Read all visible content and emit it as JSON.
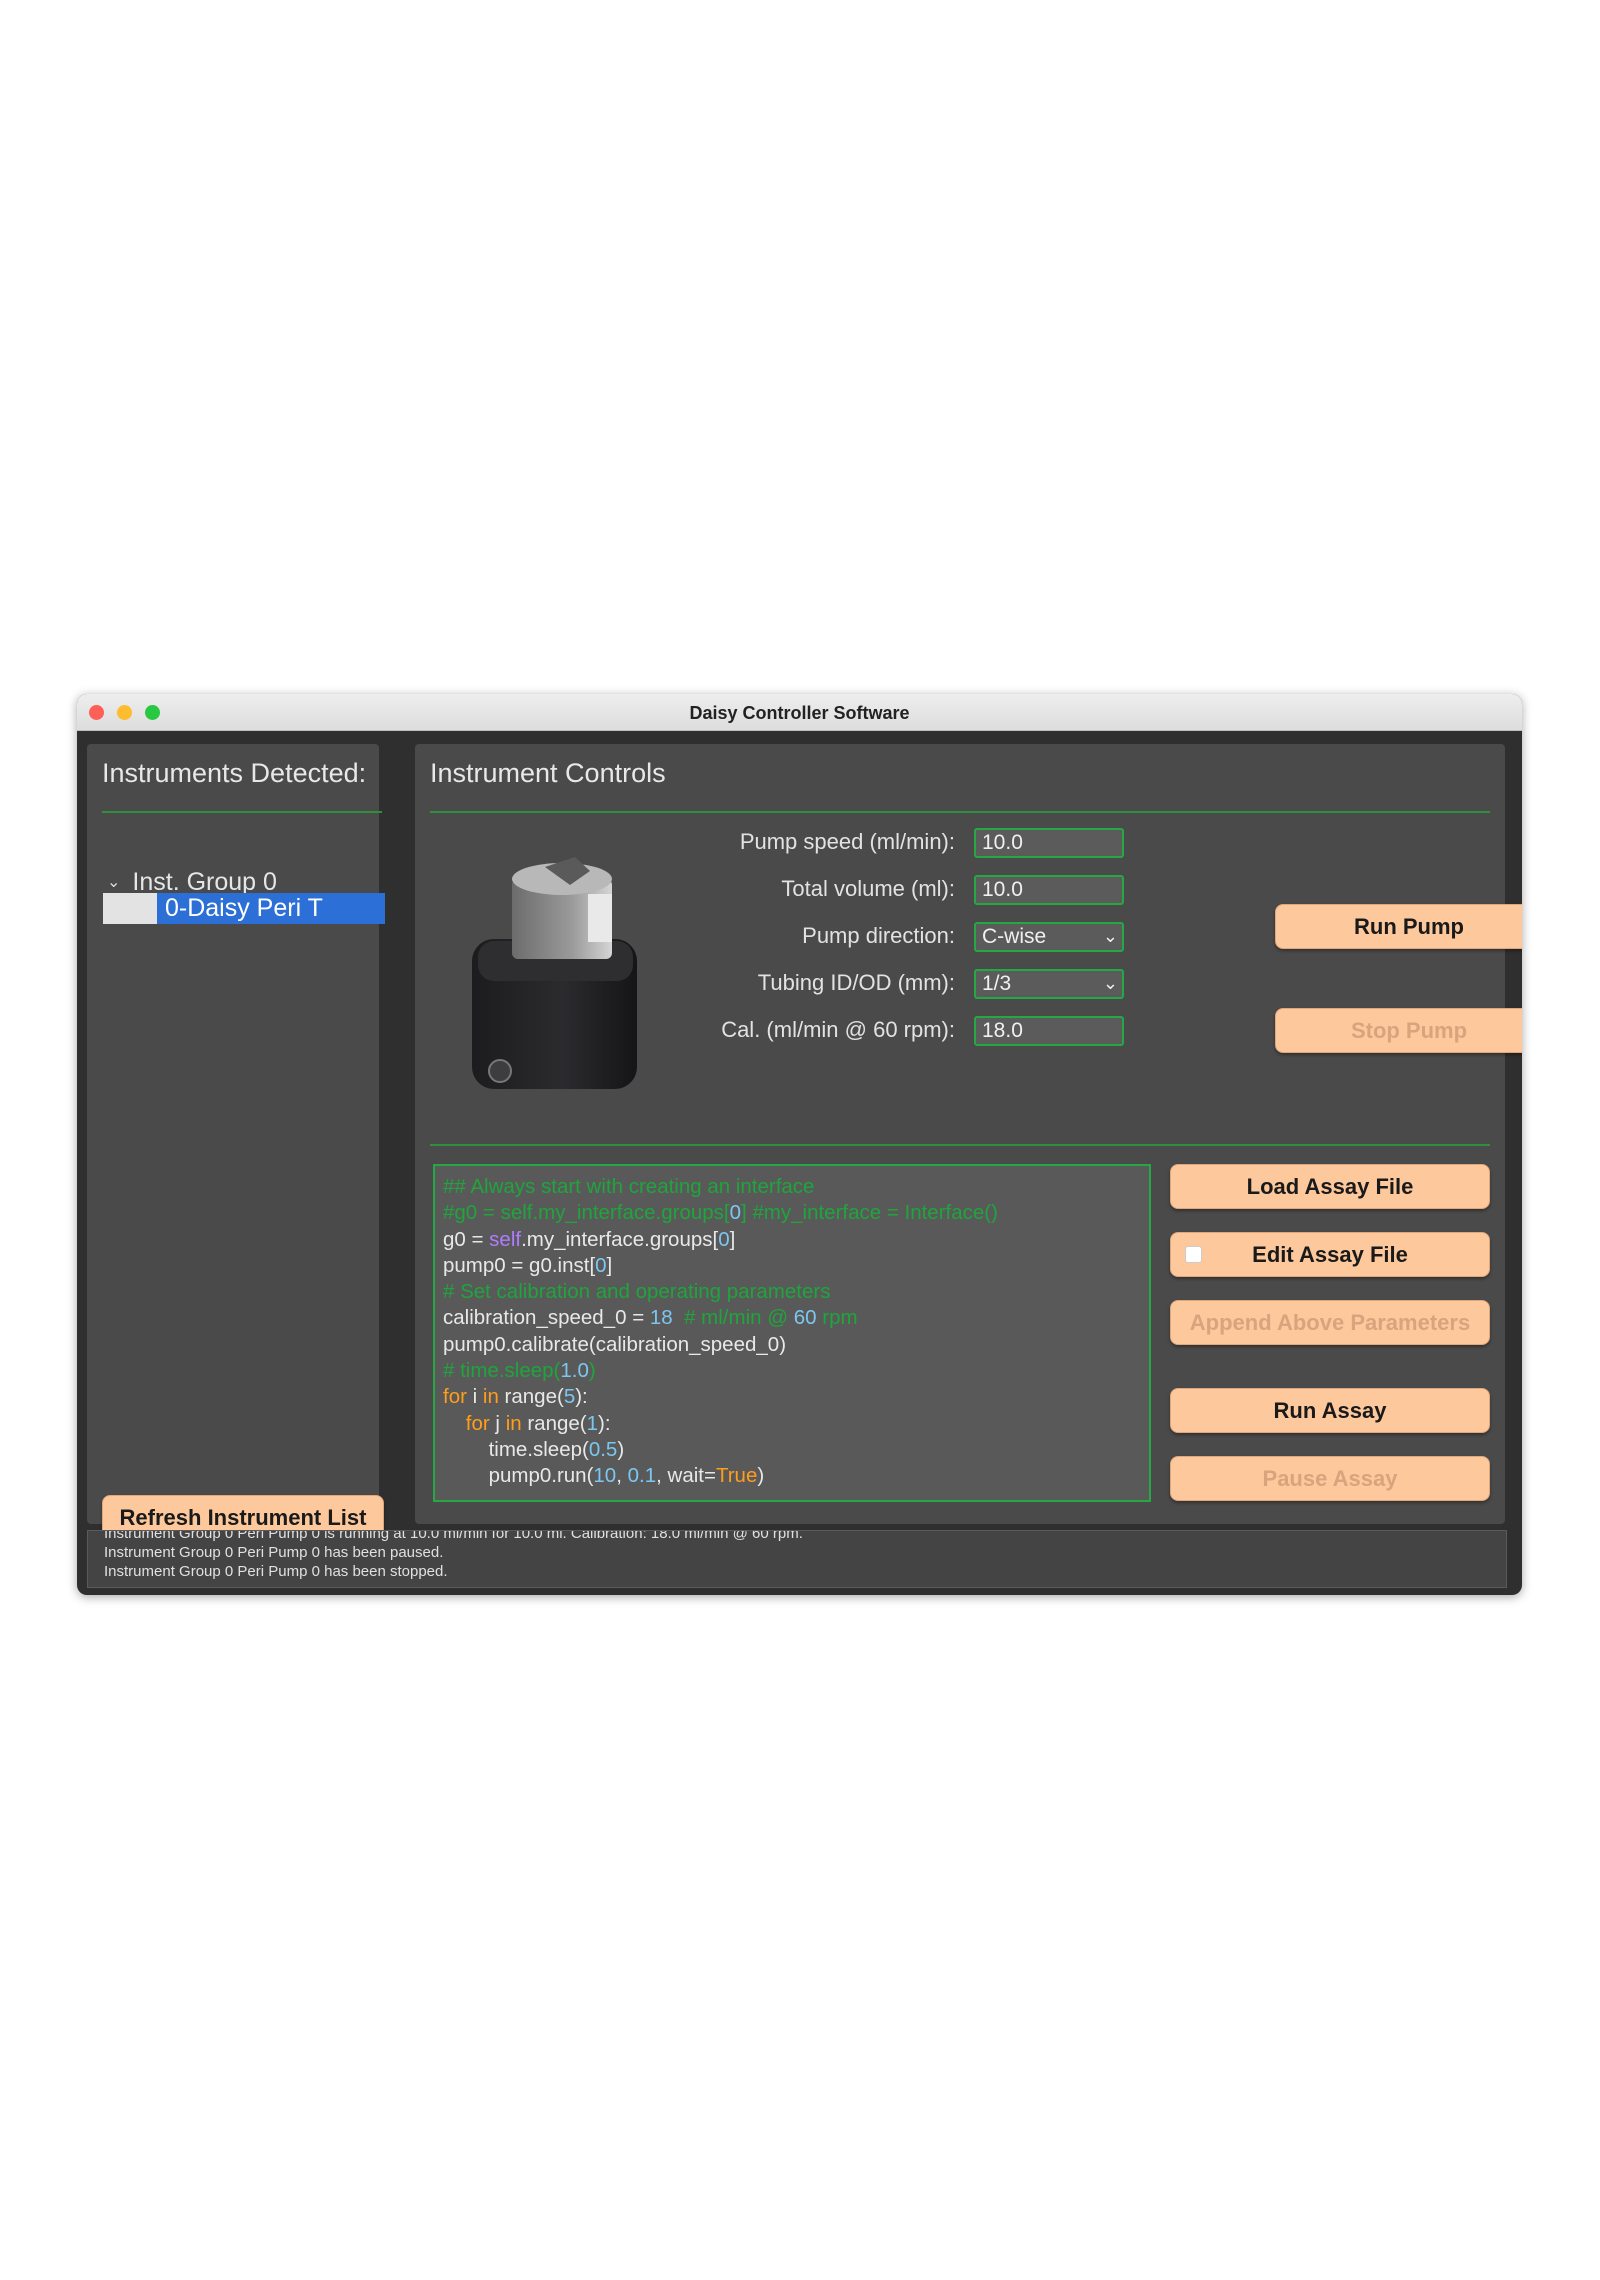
{
  "window": {
    "title": "Daisy Controller Software"
  },
  "instruments_panel": {
    "heading": "Instruments Detected:",
    "groups": [
      {
        "label": "Inst. Group 0",
        "items": [
          {
            "label": "0-Daisy Peri T",
            "selected": true
          }
        ]
      }
    ],
    "refresh_button": "Refresh Instrument List"
  },
  "controls_panel": {
    "heading": "Instrument Controls",
    "device_image": "peristaltic-pump-photo",
    "params": [
      {
        "label": "Pump speed (ml/min):",
        "value": "10.0",
        "kind": "text"
      },
      {
        "label": "Total volume (ml):",
        "value": "10.0",
        "kind": "text"
      },
      {
        "label": "Pump direction:",
        "value": "C-wise",
        "kind": "select"
      },
      {
        "label": "Tubing ID/OD (mm):",
        "value": "1/3",
        "kind": "select"
      },
      {
        "label": "Cal. (ml/min @ 60 rpm):",
        "value": "18.0",
        "kind": "text"
      }
    ],
    "run_pump_button": "Run Pump",
    "stop_pump_button": "Stop Pump",
    "stop_pump_enabled": false
  },
  "assay": {
    "code_lines": [
      [
        {
          "t": "## Always start with creating an interface",
          "c": "comment"
        }
      ],
      [
        {
          "t": "#g0 = self.my_interface.groups[",
          "c": "comment"
        },
        {
          "t": "0",
          "c": "num"
        },
        {
          "t": "] #my_interface = Interface()",
          "c": "comment"
        }
      ],
      [
        {
          "t": "g0 = ",
          "c": "plain"
        },
        {
          "t": "self",
          "c": "self"
        },
        {
          "t": ".my_interface.groups[",
          "c": "plain"
        },
        {
          "t": "0",
          "c": "num"
        },
        {
          "t": "]",
          "c": "plain"
        }
      ],
      [
        {
          "t": "pump0 = g0.inst[",
          "c": "plain"
        },
        {
          "t": "0",
          "c": "num"
        },
        {
          "t": "]",
          "c": "plain"
        }
      ],
      [
        {
          "t": "# Set calibration and operating parameters",
          "c": "comment"
        }
      ],
      [
        {
          "t": "calibration_speed_0 = ",
          "c": "plain"
        },
        {
          "t": "18",
          "c": "num"
        },
        {
          "t": "  # ml/min @ ",
          "c": "comment"
        },
        {
          "t": "60",
          "c": "num"
        },
        {
          "t": " rpm",
          "c": "comment"
        }
      ],
      [
        {
          "t": "pump0.calibrate(calibration_speed_0)",
          "c": "plain"
        }
      ],
      [
        {
          "t": "# time.sleep(",
          "c": "comment"
        },
        {
          "t": "1.0",
          "c": "num"
        },
        {
          "t": ")",
          "c": "comment"
        }
      ],
      [
        {
          "t": "for",
          "c": "kw"
        },
        {
          "t": " i ",
          "c": "plain"
        },
        {
          "t": "in",
          "c": "kw"
        },
        {
          "t": " range(",
          "c": "plain"
        },
        {
          "t": "5",
          "c": "num"
        },
        {
          "t": "):",
          "c": "plain"
        }
      ],
      [
        {
          "t": "    ",
          "c": "plain"
        },
        {
          "t": "for",
          "c": "kw"
        },
        {
          "t": " j ",
          "c": "plain"
        },
        {
          "t": "in",
          "c": "kw"
        },
        {
          "t": " range(",
          "c": "plain"
        },
        {
          "t": "1",
          "c": "num"
        },
        {
          "t": "):",
          "c": "plain"
        }
      ],
      [
        {
          "t": "        time.sleep(",
          "c": "plain"
        },
        {
          "t": "0.5",
          "c": "num"
        },
        {
          "t": ")",
          "c": "plain"
        }
      ],
      [
        {
          "t": "        pump0.run(",
          "c": "plain"
        },
        {
          "t": "10",
          "c": "num"
        },
        {
          "t": ", ",
          "c": "plain"
        },
        {
          "t": "0.1",
          "c": "num"
        },
        {
          "t": ", wait=",
          "c": "plain"
        },
        {
          "t": "True",
          "c": "kw"
        },
        {
          "t": ")",
          "c": "plain"
        }
      ]
    ],
    "load_button": "Load Assay File",
    "edit_button": "Edit Assay File",
    "edit_checked": false,
    "append_button": "Append Above Parameters",
    "append_enabled": false,
    "run_button": "Run Assay",
    "pause_button": "Pause Assay",
    "pause_enabled": false
  },
  "log": {
    "lines": [
      "Instrument Group 0 Peri Pump 0 is running at  10.0 ml/min for 10.0 ml. Calibration: 18.0 ml/min @ 60 rpm.",
      "Instrument Group 0 Peri Pump 0 has been paused.",
      "Instrument Group 0 Peri Pump 0 has been stopped."
    ]
  },
  "colors": {
    "window_bg": "#2f2f2f",
    "panel_bg": "#4a4a4a",
    "accent_green": "#25a844",
    "button_bg": "#fdc89c",
    "selection_blue": "#2c6fd6"
  }
}
